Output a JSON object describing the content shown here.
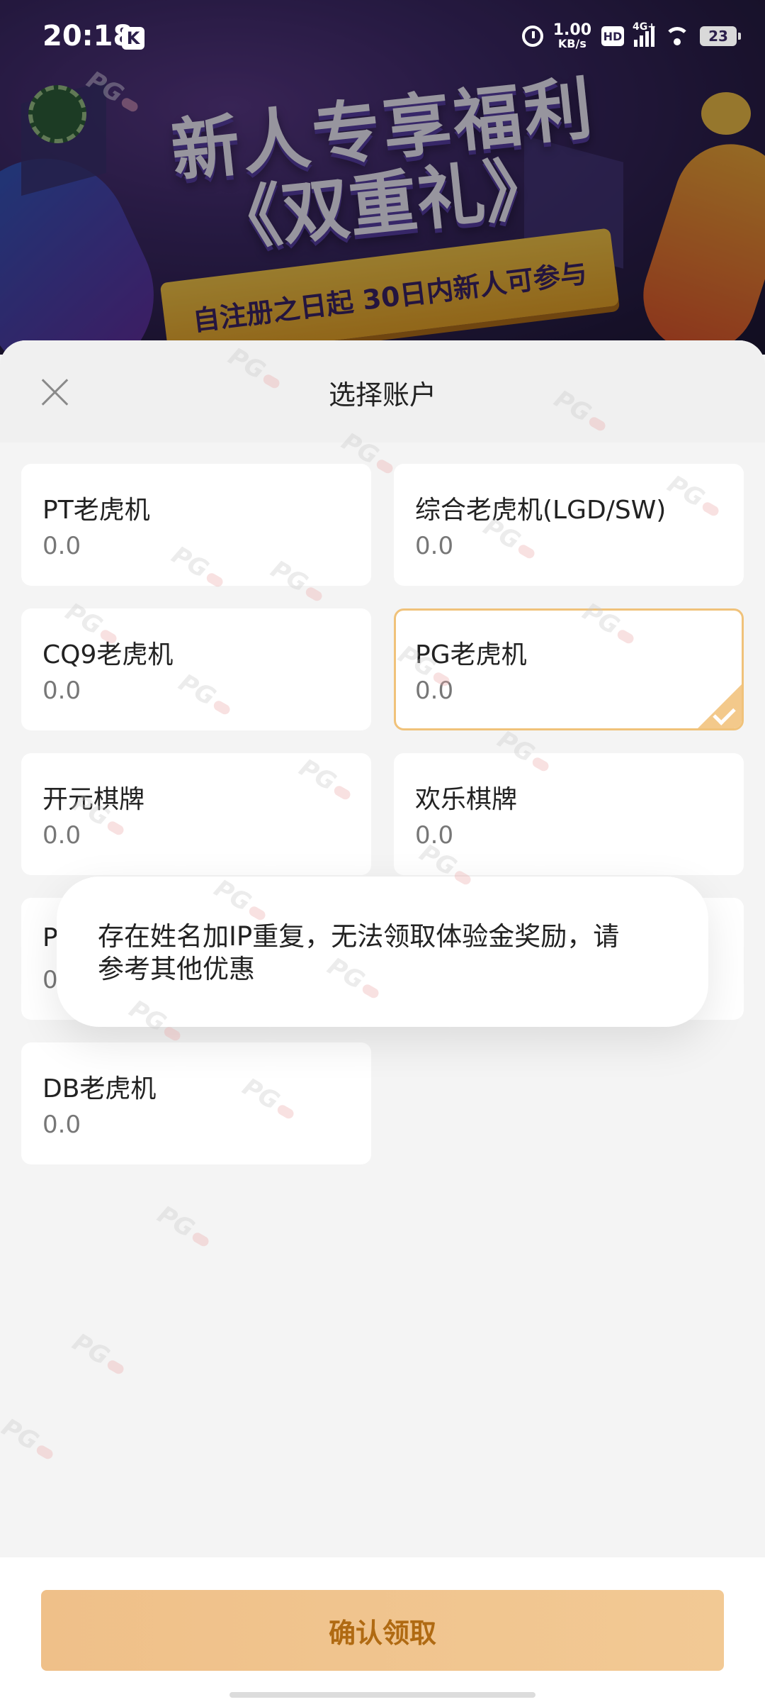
{
  "status_bar": {
    "time": "20:18",
    "k_badge": "K",
    "net_speed_value": "1.00",
    "net_speed_unit": "KB/s",
    "hd_badge": "HD",
    "signal_label": "4G+",
    "battery": "23"
  },
  "banner": {
    "title": "新人专享福利",
    "subtitle": "《双重礼》",
    "ribbon": "自注册之日起 30日内新人可参与"
  },
  "sheet": {
    "title": "选择账户"
  },
  "accounts": [
    {
      "name": "PT老虎机",
      "balance": "0.0",
      "selected": false
    },
    {
      "name": "综合老虎机(LGD/SW)",
      "balance": "0.0",
      "selected": false
    },
    {
      "name": "CQ9老虎机",
      "balance": "0.0",
      "selected": false
    },
    {
      "name": "PG老虎机",
      "balance": "0.0",
      "selected": true
    },
    {
      "name": "开元棋牌",
      "balance": "0.0",
      "selected": false
    },
    {
      "name": "欢乐棋牌",
      "balance": "0.0",
      "selected": false
    },
    {
      "name": "P",
      "balance": "0",
      "selected": false
    },
    {
      "name": "",
      "balance": "",
      "selected": false
    },
    {
      "name": "DB老虎机",
      "balance": "0.0",
      "selected": false
    }
  ],
  "toast": {
    "line1": "存在姓名加IP重复，无法领取体验金奖励，请",
    "line2": "参考其他优惠"
  },
  "confirm_button": {
    "label": "确认领取"
  },
  "watermark": {
    "text": "PG"
  },
  "colors": {
    "accent": "#f0c27a",
    "button_bg": "#f0c38c",
    "button_text": "#b06a12"
  }
}
